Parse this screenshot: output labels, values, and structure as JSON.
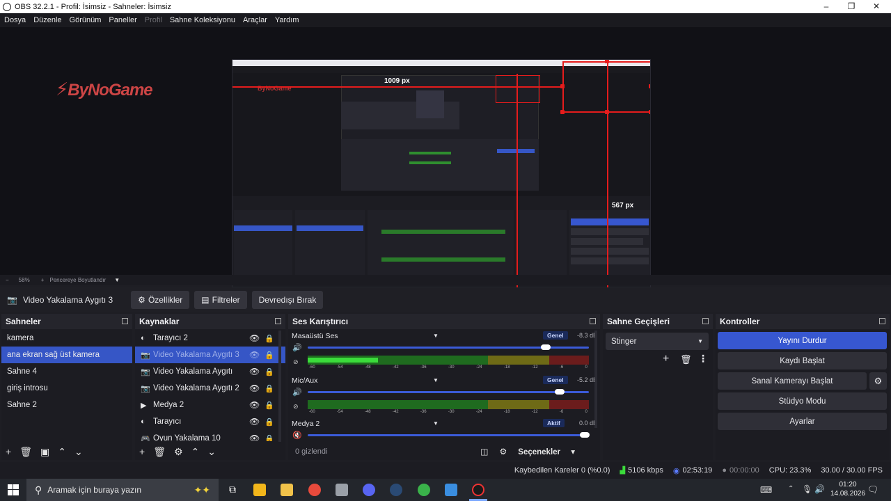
{
  "window": {
    "title": "OBS 32.2.1 - Profil: İsimsiz - Sahneler: İsimsiz",
    "controls": [
      "–",
      "❐",
      "✕"
    ]
  },
  "menu": {
    "items": [
      "Dosya",
      "Düzenle",
      "Görünüm",
      "Paneller",
      "Profil",
      "Sahne Koleksiyonu",
      "Araçlar",
      "Yardım"
    ]
  },
  "preview": {
    "logo_text": "ByNoGame",
    "nested": {
      "label_top": "1009 px",
      "label_side": "567 px"
    }
  },
  "zoombar": {
    "minus": "−",
    "zoom": "58%",
    "plus": "+",
    "fit": "Pencereye Boyutlandır"
  },
  "source_toolbar": {
    "source_name": "Video Yakalama Aygıtı 3",
    "properties": "Özellikler",
    "filters": "Filtreler",
    "deactivate": "Devredışı Bırak"
  },
  "scenes": {
    "title": "Sahneler",
    "items": [
      "kamera",
      "ana ekran sağ üst  kamera",
      "Sahne 4",
      "giriş introsu",
      "Sahne 2"
    ],
    "selected_index": 1
  },
  "sources": {
    "title": "Kaynaklar",
    "items": [
      {
        "label": "Tarayıcı 2",
        "icon": "browser-icon"
      },
      {
        "label": "Video Yakalama Aygıtı 3",
        "icon": "camera-icon"
      },
      {
        "label": "Video Yakalama Aygıtı",
        "icon": "camera-icon"
      },
      {
        "label": "Video Yakalama Aygıtı 2",
        "icon": "camera-icon"
      },
      {
        "label": "Medya 2",
        "icon": "play-icon"
      },
      {
        "label": "Tarayıcı",
        "icon": "browser-icon"
      },
      {
        "label": "Oyun Yakalama 10",
        "icon": "gamepad-icon"
      }
    ],
    "selected_index": 1
  },
  "mixer": {
    "title": "Ses Karıştırıcı",
    "channels": [
      {
        "name": "Masaüstü Ses",
        "badge": "Genel",
        "db": "-8.3 dB",
        "volume": 0.86,
        "level": 0.25
      },
      {
        "name": "Mic/Aux",
        "badge": "Genel",
        "db": "-5.2 dB",
        "volume": 0.91,
        "level": 0.0
      },
      {
        "name": "Medya 2",
        "badge": "Aktif",
        "db": "0.0 dB",
        "volume": 1.0,
        "level": 0.0
      }
    ],
    "ticks": [
      "-60",
      "-54",
      "-48",
      "-42",
      "-36",
      "-30",
      "-24",
      "-18",
      "-12",
      "-6",
      "0"
    ],
    "hidden": "0 gizlendi",
    "options": "Seçenekler"
  },
  "transitions": {
    "title": "Sahne Geçişleri",
    "selected": "Stinger"
  },
  "controls": {
    "title": "Kontroller",
    "stop_stream": "Yayını Durdur",
    "start_record": "Kaydı Başlat",
    "start_vcam": "Sanal Kamerayı Başlat",
    "studio_mode": "Stüdyo Modu",
    "settings": "Ayarlar"
  },
  "status": {
    "dropped": "Kaybedilen Kareler 0 (%0.0)",
    "bitrate": "5106 kbps",
    "stream_time": "02:53:19",
    "record_time": "00:00:00",
    "cpu": "CPU: 23.3%",
    "fps": "30.00 / 30.00 FPS"
  },
  "taskbar": {
    "search_placeholder": "Aramak için buraya yazın",
    "time": "01:20",
    "date": "14.08.2026"
  },
  "colors": {
    "accent": "#3757d0",
    "red_guides": "#e51c1c",
    "meter_green": "#3bdc3b"
  }
}
